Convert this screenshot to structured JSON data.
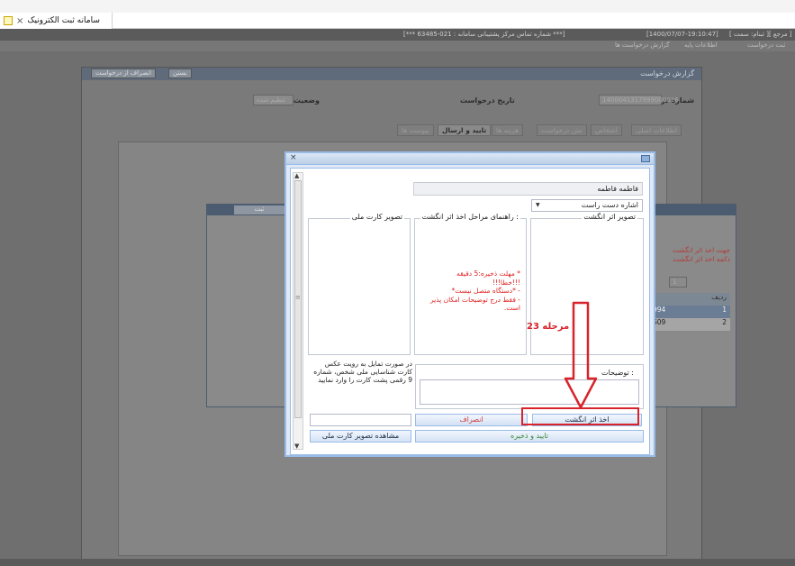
{
  "browser": {
    "tab_title": "سامانه ثبت الکترونیک",
    "tab_close": "×"
  },
  "statusbar": {
    "datetime": "[1400/07/07-19:10:47]",
    "support_text": "[*** شماره تماس مرکز پشتیبانی سامانه : 021-63485 ***]",
    "user_text": "[ ثبنام: سمت ][ مرجع ]"
  },
  "menubar": {
    "items": [
      "ثبت درخواست",
      "اطلاعات پایه",
      "گزارش درخواست ها"
    ]
  },
  "background": {
    "panel_title": "گزارش درخواست",
    "panel_button_1": "بستن",
    "panel_button_2": "انصراف از درخواست",
    "request_no_label": "شماره درخواست",
    "request_no_value": "1400041317999000016",
    "request_date_label": "تاریخ درخواست",
    "status_label": "وضعیت",
    "status_value": "تنظیم شده",
    "tabs": [
      "اطلاعات اصلی",
      "اشخاص",
      "متن درخواست",
      "هزینه ها",
      "تایید و ارسال",
      "پیوست ها"
    ],
    "active_tab_index": 4,
    "dialog_button": "ثبت",
    "red_text_lines": [
      "جهت اخذ اثر انگشت",
      "دکمه اخذ اثر انگشت"
    ],
    "table_header": "ردیف",
    "table_rows": [
      [
        "1",
        "994"
      ],
      [
        "2",
        "609"
      ]
    ],
    "page_value": "1"
  },
  "modal": {
    "name_value": "فاطمه فاطمه",
    "finger_select": "اشاره دست راست",
    "fieldset_photo": "تصویر اثر انگشت",
    "fieldset_guide": "راهنمای مراحل اخذ اثر انگشت :",
    "fieldset_card": "تصویر کارت ملی",
    "guide_messages": [
      "* مهلت ذخیره:5 دقیقه",
      "!!!خطا!!!",
      "- *دستگاه متصل نیست*",
      "- فقط درج توضیحات امکان پذیر",
      "است."
    ],
    "card_note": "در صورت تمایل به رویت عکس کارت شناسایی ملی شخص، شماره 9 رقمی پشت کارت را وارد نمایید",
    "desc_label": "توضیحات :",
    "btn_finger": "اخذ اثر انگشت",
    "btn_cancel": "انصراف",
    "btn_confirm": "تایید و ذخیره",
    "btn_view_card": "مشاهده تصویر کارت ملی",
    "close_glyph": "×"
  },
  "annotation": {
    "label": "مرحله 23",
    "color": "#d8232a"
  },
  "colors": {
    "modal_border": "#99bbe8",
    "modal_bg": "#dfe8f6",
    "accent_red": "#e02020"
  }
}
